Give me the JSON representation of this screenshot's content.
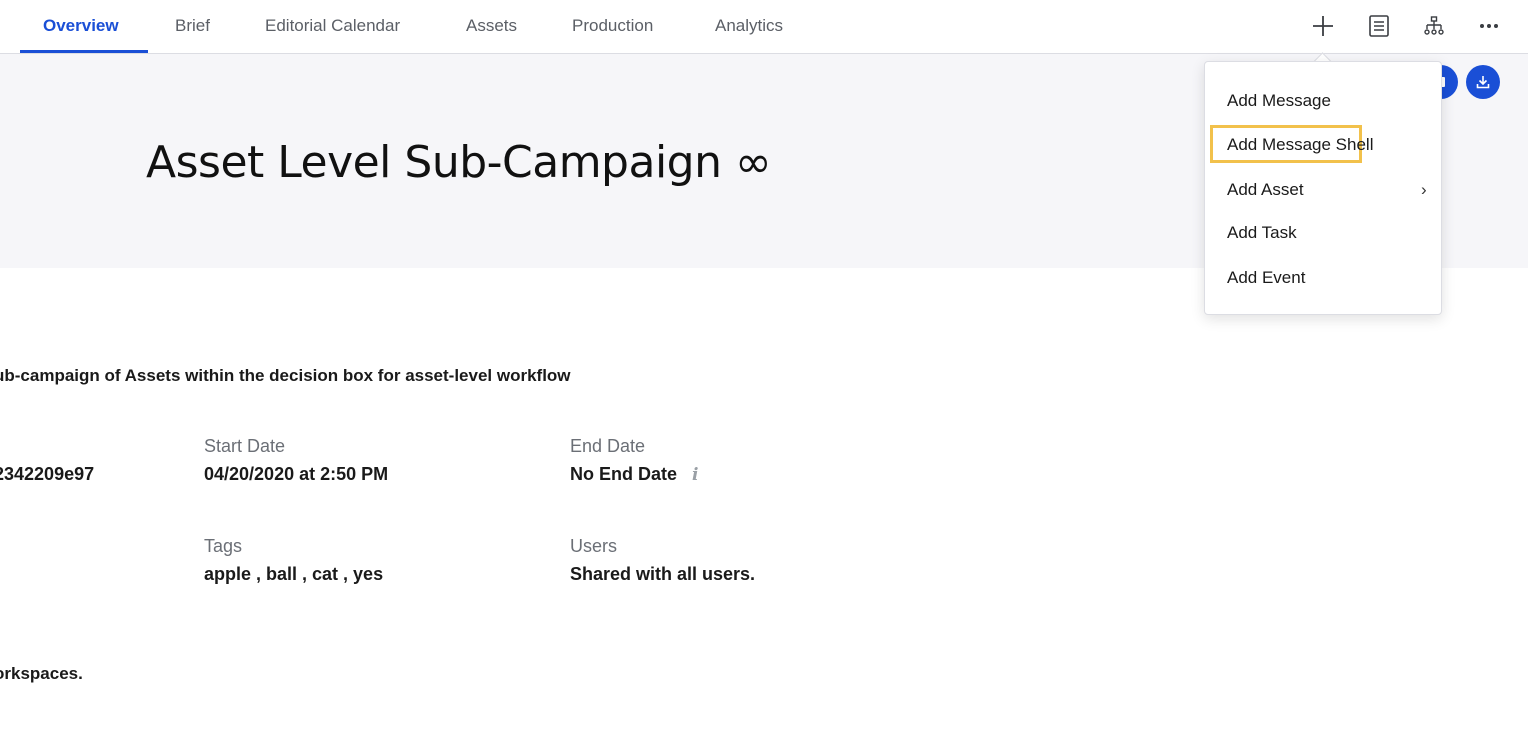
{
  "tabs": [
    {
      "label": "Overview",
      "active": true
    },
    {
      "label": "Brief",
      "active": false
    },
    {
      "label": "Editorial Calendar",
      "active": false
    },
    {
      "label": "Assets",
      "active": false
    },
    {
      "label": "Production",
      "active": false
    },
    {
      "label": "Analytics",
      "active": false
    }
  ],
  "toolbar": {
    "icons": [
      "plus-icon",
      "document-list-icon",
      "hierarchy-icon",
      "more-icon"
    ]
  },
  "header": {
    "title": "Asset Level Sub-Campaign",
    "title_symbol": "∞"
  },
  "description": "ub-campaign of Assets within the decision box for asset-level workflow",
  "details": {
    "id_value": "2342209e97",
    "start_date": {
      "label": "Start Date",
      "value": "04/20/2020 at 2:50 PM"
    },
    "end_date": {
      "label": "End Date",
      "value": "No End Date",
      "info": "i"
    },
    "tags": {
      "label": "Tags",
      "value": "apple , ball , cat , yes"
    },
    "users": {
      "label": "Users",
      "value": "Shared with all users."
    }
  },
  "workspaces_text": "orkspaces.",
  "add_menu": {
    "items": [
      {
        "label": "Add Message"
      },
      {
        "label": "Add Message Shell",
        "highlighted": true
      },
      {
        "label": "Add Asset",
        "has_submenu": true
      },
      {
        "label": "Add Task"
      },
      {
        "label": "Add Event"
      }
    ],
    "submenu_chevron": "›"
  },
  "colors": {
    "accent": "#1a4fd6",
    "highlight": "#f2c14b",
    "hero_bg": "#f6f6f9"
  }
}
